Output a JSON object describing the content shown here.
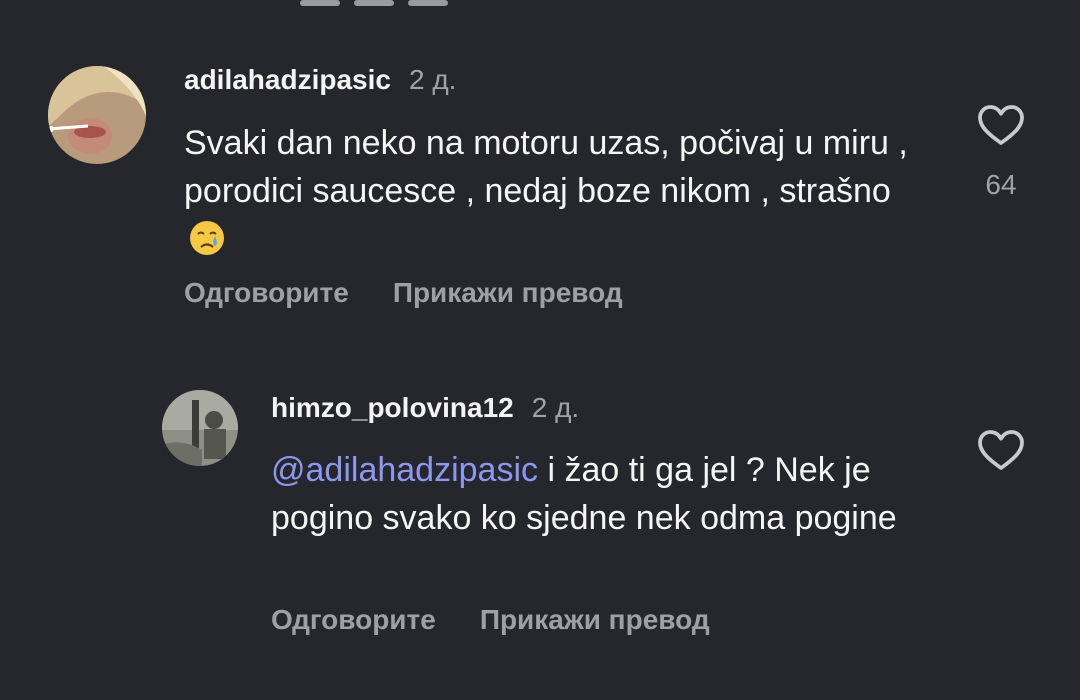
{
  "comments": [
    {
      "username": "adilahadzipasic",
      "time": "2 д.",
      "text": "Svaki dan neko na motoru uzas, počivaj u miru , porodici saucesce , nedaj boze nikom , strašno",
      "emoji": "crying-face",
      "likes": "64",
      "reply_label": "Одговорите",
      "translate_label": "Прикажи превод"
    },
    {
      "username": "himzo_polovina12",
      "time": "2 д.",
      "mention": "@adilahadzipasic",
      "text": " i žao ti ga jel ? Nek je pogino svako ko sjedne nek odma pogine",
      "reply_label": "Одговорите",
      "translate_label": "Прикажи превод"
    }
  ],
  "icons": {
    "like": "heart-outline-icon",
    "emoji": "crying-face-icon"
  },
  "colors": {
    "background": "#26272c",
    "mention": "#8c98f0",
    "secondary_text": "#a2a3a8"
  }
}
